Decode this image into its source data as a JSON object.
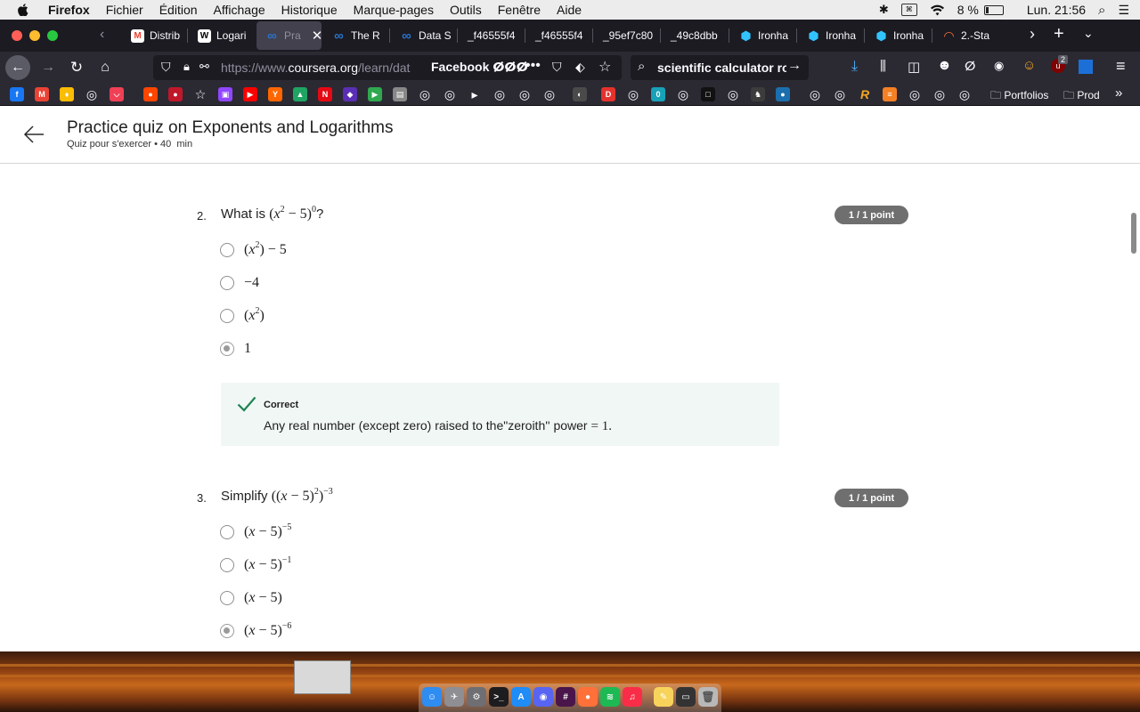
{
  "menubar": {
    "app": "Firefox",
    "items": [
      "Fichier",
      "Édition",
      "Affichage",
      "Historique",
      "Marque-pages",
      "Outils",
      "Fenêtre",
      "Aide"
    ],
    "battery": "8 %",
    "clock": "Lun. 21:56"
  },
  "tabs": [
    {
      "label": "Distrib",
      "icon": "gmail-icon",
      "color": "#ea4335",
      "glyph": "M"
    },
    {
      "label": "Logari",
      "icon": "wikipedia-icon",
      "color": "#ffffff",
      "glyph": "W"
    },
    {
      "label": "Pra",
      "icon": "coursera-icon",
      "color": "#2a73cc",
      "glyph": "∞",
      "active": true
    },
    {
      "label": "The R",
      "icon": "coursera-icon",
      "color": "#2a73cc",
      "glyph": "∞"
    },
    {
      "label": "Data S",
      "icon": "coursera-icon",
      "color": "#2a73cc",
      "glyph": "∞"
    },
    {
      "label": "_f46555f4",
      "icon": "blank-icon",
      "color": "",
      "glyph": ""
    },
    {
      "label": "_f46555f4",
      "icon": "blank-icon",
      "color": "",
      "glyph": ""
    },
    {
      "label": "_95ef7c80",
      "icon": "blank-icon",
      "color": "",
      "glyph": ""
    },
    {
      "label": "_49c8dbb",
      "icon": "blank-icon",
      "color": "",
      "glyph": ""
    },
    {
      "label": "Ironha",
      "icon": "ironhack-icon",
      "color": "#32c3ff",
      "glyph": "⬢"
    },
    {
      "label": "Ironha",
      "icon": "ironhack-icon",
      "color": "#32c3ff",
      "glyph": "⬢"
    },
    {
      "label": "Ironha",
      "icon": "ironhack-icon",
      "color": "#32c3ff",
      "glyph": "⬢"
    },
    {
      "label": "2.-Sta",
      "icon": "loading-icon",
      "color": "#ff7139",
      "glyph": "◠"
    }
  ],
  "nav": {
    "url_prefix": "https://www.",
    "url_domain": "coursera.org",
    "url_path": "/learn/dat",
    "url_extra": "Facebook ⵁⵁⵁ",
    "search_value": "scientific calculator ro"
  },
  "bookmarks": {
    "folders": [
      "Portfolios",
      "Prod"
    ],
    "icons": [
      {
        "name": "facebook-icon",
        "color": "#1877f2",
        "glyph": "f"
      },
      {
        "name": "gmail-icon",
        "color": "#ea4335",
        "glyph": "M"
      },
      {
        "name": "keep-icon",
        "color": "#fbbc04",
        "glyph": "♦"
      },
      {
        "name": "globe-icon",
        "color": "",
        "glyph": "◎"
      },
      {
        "name": "pocket-icon",
        "color": "#ef4056",
        "glyph": "⌵"
      },
      {
        "name": "reddit-icon",
        "color": "#ff4500",
        "glyph": "●"
      },
      {
        "name": "gamepad-icon",
        "color": "#c0182a",
        "glyph": "●"
      },
      {
        "name": "star-icon",
        "color": "",
        "glyph": "☆"
      },
      {
        "name": "twitch-icon",
        "color": "#9146ff",
        "glyph": "▣"
      },
      {
        "name": "youtube-icon",
        "color": "#ff0000",
        "glyph": "▶"
      },
      {
        "name": "ycombinator-icon",
        "color": "#ff6600",
        "glyph": "Y"
      },
      {
        "name": "drive-icon",
        "color": "#1fa463",
        "glyph": "▲"
      },
      {
        "name": "netflix-icon",
        "color": "#e50914",
        "glyph": "N"
      },
      {
        "name": "vpn-icon",
        "color": "#5a2fb5",
        "glyph": "◆"
      },
      {
        "name": "play-icon",
        "color": "#2fa84f",
        "glyph": "▶"
      },
      {
        "name": "window-icon",
        "color": "#888888",
        "glyph": "▤"
      },
      {
        "name": "globe-icon",
        "color": "",
        "glyph": "◎"
      },
      {
        "name": "globe-icon",
        "color": "",
        "glyph": "◎"
      },
      {
        "name": "triangle-icon",
        "color": "",
        "glyph": "▸"
      },
      {
        "name": "globe-icon",
        "color": "",
        "glyph": "◎"
      },
      {
        "name": "globe-icon",
        "color": "",
        "glyph": "◎"
      },
      {
        "name": "globe-icon",
        "color": "",
        "glyph": "◎"
      },
      {
        "name": "github-icon",
        "color": "#4a4a4a",
        "glyph": "◐"
      },
      {
        "name": "d-icon",
        "color": "#e5322d",
        "glyph": "D"
      },
      {
        "name": "globe-icon",
        "color": "",
        "glyph": "◎"
      },
      {
        "name": "codepen-icon",
        "color": "#18a2b8",
        "glyph": "0"
      },
      {
        "name": "globe-icon",
        "color": "",
        "glyph": "◎"
      },
      {
        "name": "codesandbox-icon",
        "color": "#111111",
        "glyph": "□"
      },
      {
        "name": "globe-icon",
        "color": "",
        "glyph": "◎"
      },
      {
        "name": "chess-icon",
        "color": "#3c3c3c",
        "glyph": "♞"
      },
      {
        "name": "steam-icon",
        "color": "#1b6fae",
        "glyph": "●"
      },
      {
        "name": "globe-icon",
        "color": "",
        "glyph": "◎"
      },
      {
        "name": "globe-icon",
        "color": "",
        "glyph": "◎"
      },
      {
        "name": "r-icon",
        "color": "",
        "glyph": "R"
      },
      {
        "name": "stackoverflow-icon",
        "color": "#f48024",
        "glyph": "≡"
      },
      {
        "name": "globe-icon",
        "color": "",
        "glyph": "◎"
      },
      {
        "name": "globe-icon",
        "color": "",
        "glyph": "◎"
      },
      {
        "name": "globe-icon",
        "color": "",
        "glyph": "◎"
      }
    ]
  },
  "page": {
    "title": "Practice quiz on Exponents and Logarithms",
    "subtitle": "Quiz pour s'exercer • 40  min",
    "q2": {
      "number": "2.",
      "prefix": "What is",
      "points": "1 / 1 point",
      "options": [
        "(x²) − 5",
        "−4",
        "(x²)",
        "1"
      ],
      "feedback_title": "Correct",
      "feedback_text": "Any real number (except zero) raised to the\"zeroith'' power",
      "feedback_eq": "= 1."
    },
    "q3": {
      "number": "3.",
      "prefix": "Simplify",
      "points": "1 / 1 point",
      "options": [
        "(x − 5)^−5",
        "(x − 5)^−1",
        "(x − 5)",
        "(x − 5)^−6"
      ]
    }
  },
  "dock": {
    "apps": [
      {
        "name": "finder-icon",
        "color": "#2f8cf0",
        "glyph": "☺"
      },
      {
        "name": "launchpad-icon",
        "color": "#8e8e93",
        "glyph": "✈"
      },
      {
        "name": "preferences-icon",
        "color": "#6e6e73",
        "glyph": "⚙"
      },
      {
        "name": "terminal-icon",
        "color": "#1d1d1f",
        "glyph": ">_"
      },
      {
        "name": "appstore-icon",
        "color": "#1f8cf7",
        "glyph": "A"
      },
      {
        "name": "discord-icon",
        "color": "#5865f2",
        "glyph": "◉"
      },
      {
        "name": "slack-icon",
        "color": "#4a154b",
        "glyph": "#"
      },
      {
        "name": "firefox-icon",
        "color": "#ff7139",
        "glyph": "●"
      },
      {
        "name": "spotify-icon",
        "color": "#1db954",
        "glyph": "≋"
      },
      {
        "name": "music-icon",
        "color": "#fa2d48",
        "glyph": "♫"
      },
      {
        "name": "notes-icon",
        "color": "#f7d35b",
        "glyph": "✎"
      },
      {
        "name": "briefcase-icon",
        "color": "#333333",
        "glyph": "▭"
      },
      {
        "name": "trash-icon",
        "color": "#b8b8b8",
        "glyph": "🗑"
      }
    ]
  }
}
